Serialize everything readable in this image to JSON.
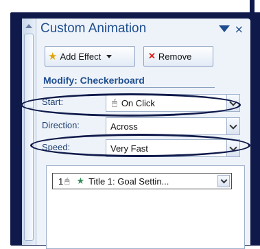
{
  "panel": {
    "title": "Custom Animation",
    "close_glyph": "×",
    "icons": [
      "chevron-down-icon",
      "close-icon",
      "scroll-up-icon"
    ]
  },
  "toolbar": {
    "add_effect_label": "Add Effect",
    "remove_label": "Remove",
    "add_icon": "star-icon",
    "remove_icon": "remove-x-icon"
  },
  "modify": {
    "label": "Modify: Checkerboard"
  },
  "fields": {
    "start": {
      "label": "Start:",
      "value": "On Click",
      "icon": "mouse-icon"
    },
    "direction": {
      "label": "Direction:",
      "value": "Across"
    },
    "speed": {
      "label": "Speed:",
      "value": "Very Fast"
    }
  },
  "effects_list": [
    {
      "number": "1",
      "title": "Title 1: Goal Settin...",
      "icons": [
        "mouse-icon",
        "star-icon"
      ]
    }
  ],
  "colors": {
    "accent": "#1f4e8f",
    "frame": "#0f1a4a",
    "panel_bg": "#eef3fa"
  }
}
